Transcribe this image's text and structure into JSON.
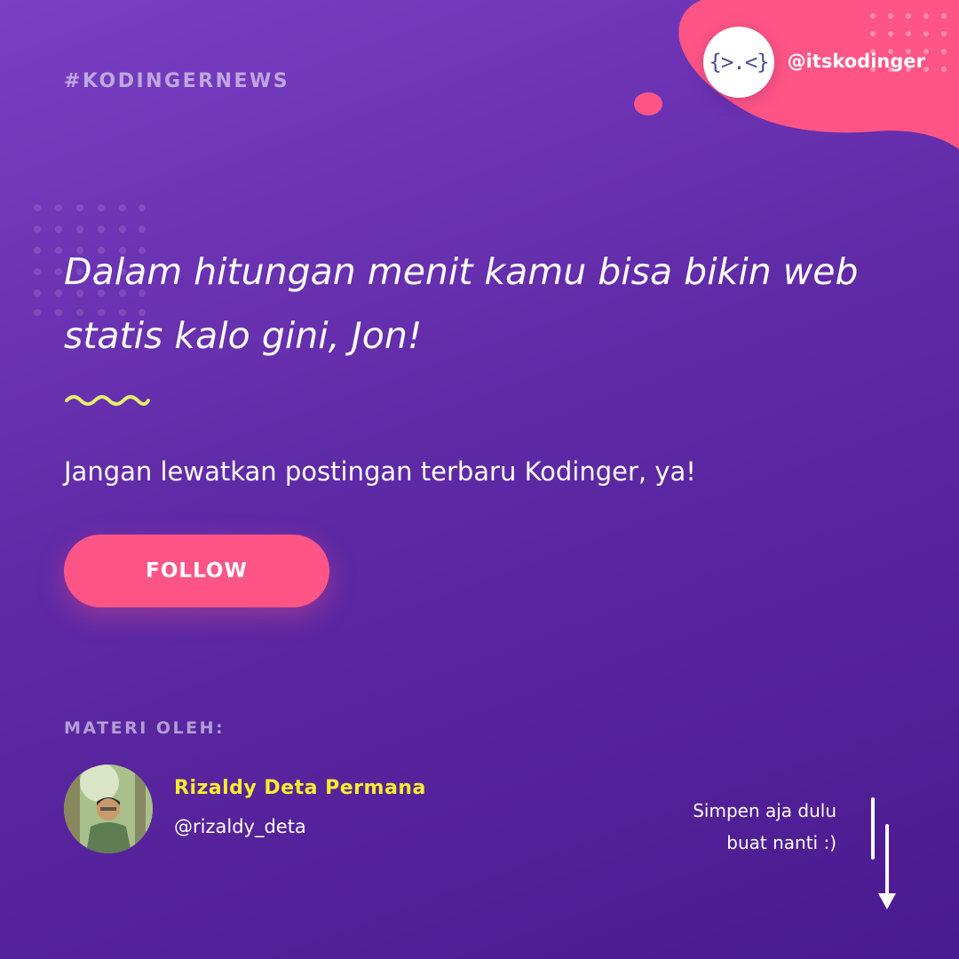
{
  "brand": {
    "hashtag": "#KODINGERNEWS",
    "handle": "@itskodinger",
    "logo_glyph": "{>.<}",
    "logo_icon": "kodinger-face-logo"
  },
  "headline": "Dalam hitungan menit kamu bisa bikin web statis kalo gini, Jon!",
  "subtitle": "Jangan lewatkan postingan terbaru Kodinger, ya!",
  "follow_label": "FOLLOW",
  "author": {
    "section_label": "MATERI OLEH:",
    "name": "Rizaldy Deta Permana",
    "handle": "@rizaldy_deta"
  },
  "save_note": {
    "line1": "Simpen aja dulu",
    "line2": "buat nanti :)"
  },
  "colors": {
    "bg_start": "#7a3fc4",
    "bg_end": "#4a1a8f",
    "accent_pink": "#ff5586",
    "accent_yellow": "#ffec2e",
    "squiggle": "#e6f06a"
  }
}
